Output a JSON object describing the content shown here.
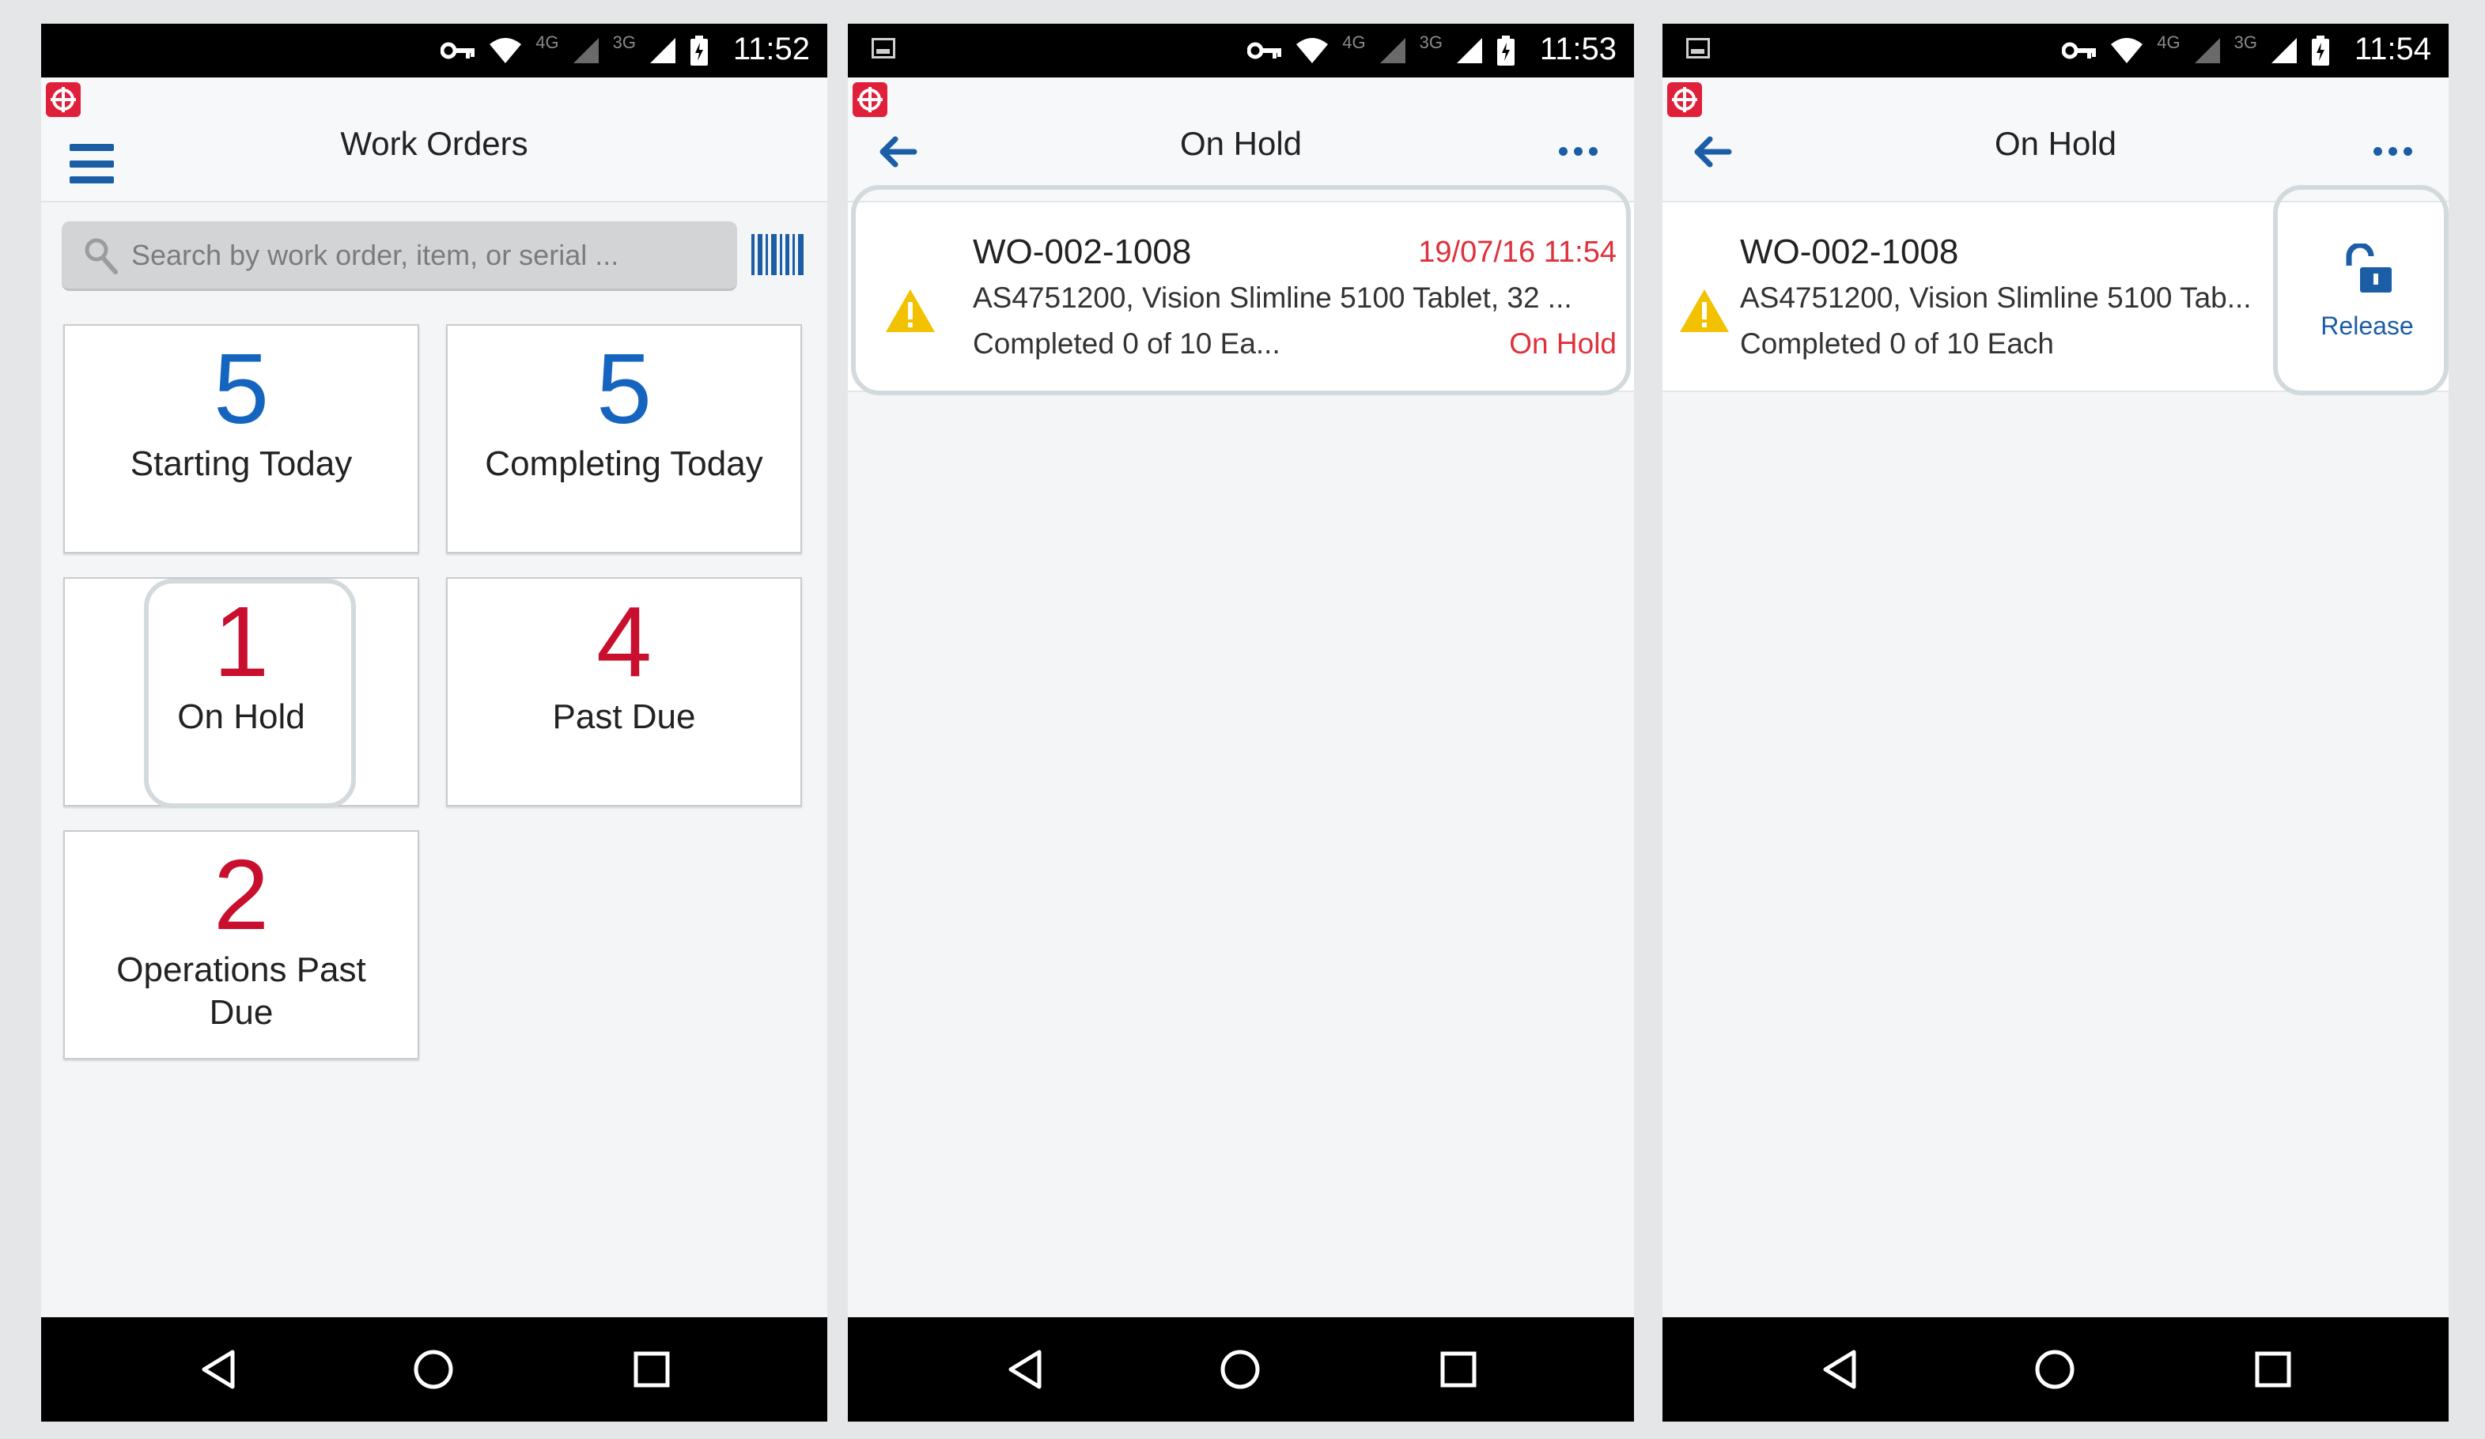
{
  "colors": {
    "accent": "#1b5ea6",
    "count_blue": "#1565c0",
    "count_red": "#c8102e",
    "status_red": "#e0303b",
    "warning": "#f2c200"
  },
  "screens": [
    {
      "status_time": "11:52",
      "network": {
        "a": "4G",
        "b": "3G"
      },
      "title": "Work Orders",
      "search_placeholder": "Search by work order, item, or serial ...",
      "tiles": [
        {
          "count": "5",
          "label": "Starting Today",
          "color": "blue"
        },
        {
          "count": "5",
          "label": "Completing Today",
          "color": "blue"
        },
        {
          "count": "1",
          "label": "On Hold",
          "color": "red"
        },
        {
          "count": "4",
          "label": "Past Due",
          "color": "red"
        },
        {
          "count": "2",
          "label_line1": "Operations Past",
          "label_line2": "Due",
          "color": "red"
        }
      ]
    },
    {
      "status_time": "11:53",
      "network": {
        "a": "4G",
        "b": "3G"
      },
      "title": "On Hold",
      "row": {
        "work_order": "WO-002-1008",
        "date": "19/07/16 11:54",
        "item": "AS4751200, Vision Slimline 5100 Tablet, 32 ...",
        "completed": "Completed 0 of 10 Ea...",
        "status": "On Hold"
      }
    },
    {
      "status_time": "11:54",
      "network": {
        "a": "4G",
        "b": "3G"
      },
      "title": "On Hold",
      "row": {
        "work_order": "WO-002-1008",
        "item": "AS4751200, Vision Slimline 5100 Tab...",
        "completed": "Completed 0 of 10 Each",
        "release_label": "Release"
      }
    }
  ],
  "icons": [
    "key-icon",
    "wifi-icon",
    "signal-icon",
    "battery-icon",
    "image-notification-icon",
    "app-logo-icon",
    "menu-icon",
    "back-arrow-icon",
    "more-icon",
    "search-icon",
    "barcode-icon",
    "warning-icon",
    "unlock-icon",
    "nav-back-icon",
    "nav-home-icon",
    "nav-recent-icon"
  ]
}
